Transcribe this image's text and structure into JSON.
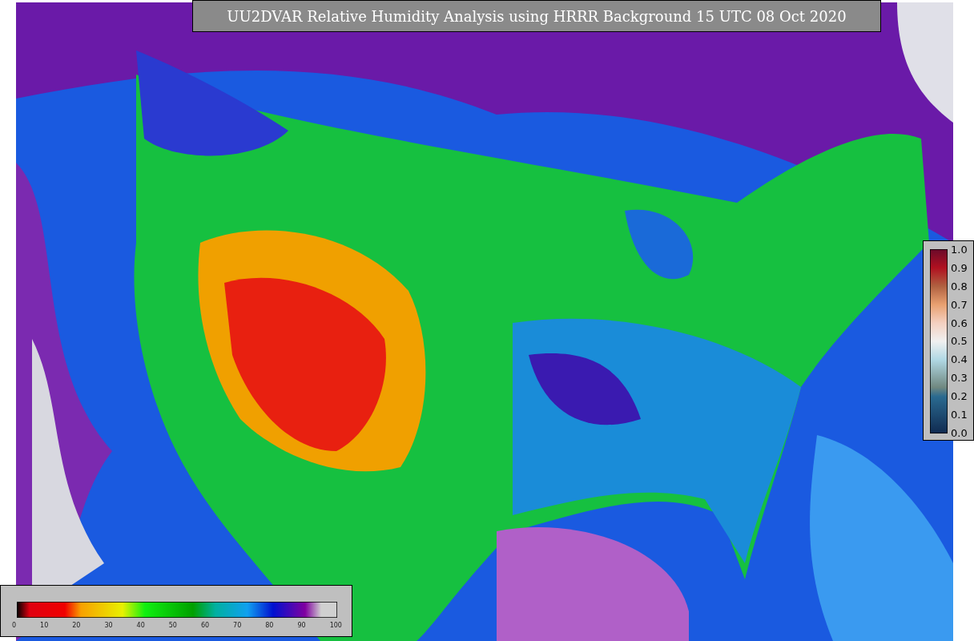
{
  "title": "UU2DVAR Relative Humidity Analysis using HRRR Background 15 UTC 08 Oct 2020",
  "humidity_colorbar": {
    "ticks": [
      "0",
      "10",
      "20",
      "30",
      "40",
      "50",
      "60",
      "70",
      "80",
      "90",
      "100"
    ]
  },
  "ratio_colorbar": {
    "ticks": [
      "1.0",
      "0.9",
      "0.8",
      "0.7",
      "0.6",
      "0.5",
      "0.4",
      "0.3",
      "0.2",
      "0.1",
      "0.0"
    ]
  }
}
